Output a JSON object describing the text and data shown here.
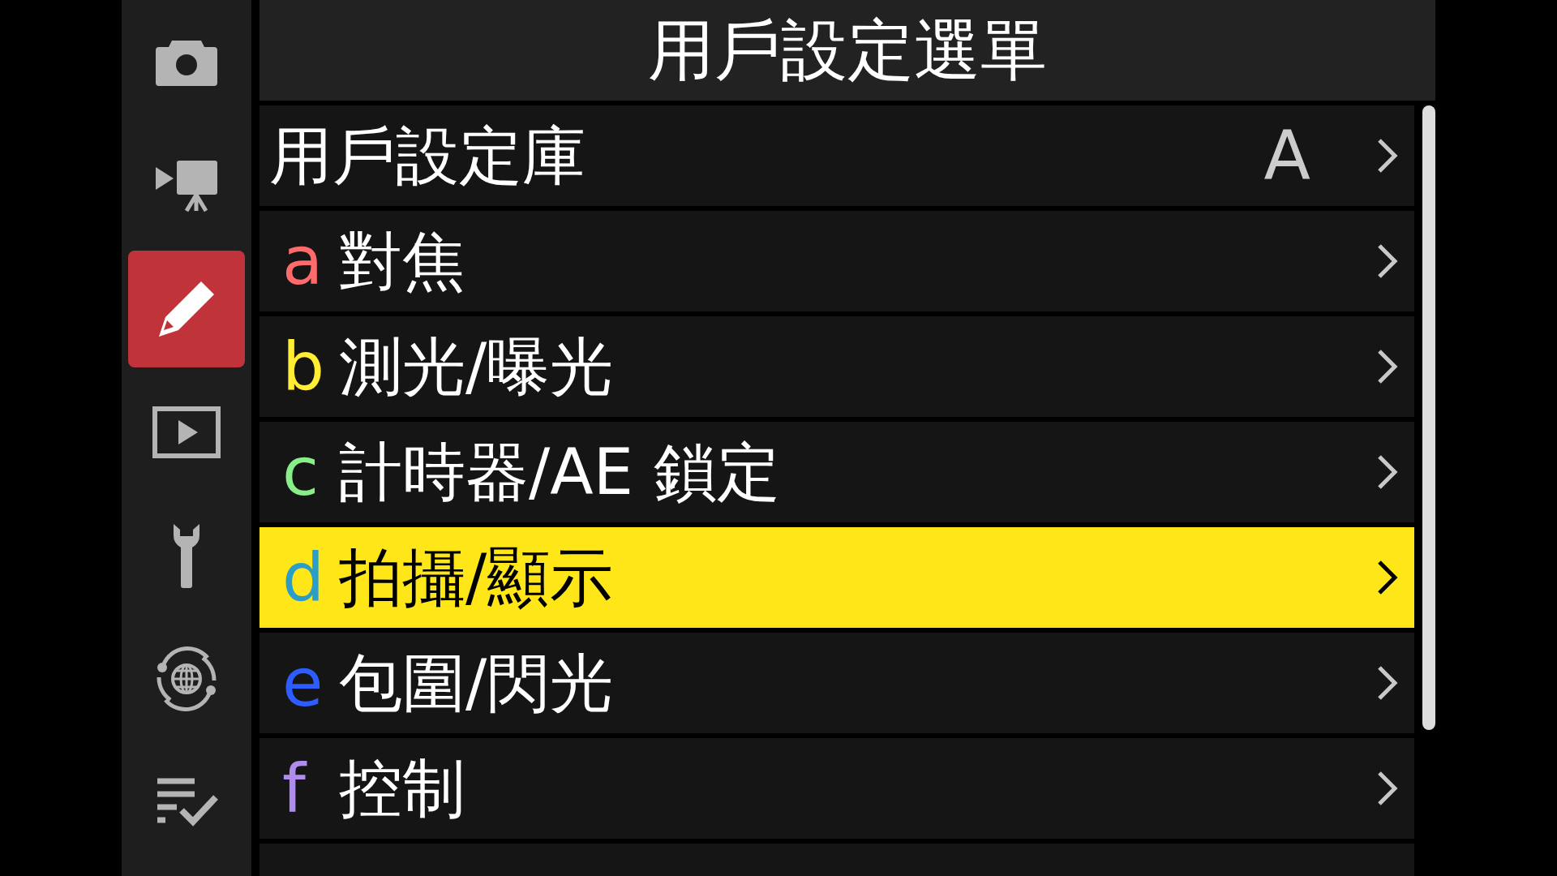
{
  "sidebar": {
    "items": [
      {
        "kind": "camera",
        "selected": false
      },
      {
        "kind": "video",
        "selected": false
      },
      {
        "kind": "pencil",
        "selected": true
      },
      {
        "kind": "playback",
        "selected": false
      },
      {
        "kind": "wrench",
        "selected": false
      },
      {
        "kind": "network",
        "selected": false
      },
      {
        "kind": "list",
        "selected": false
      }
    ]
  },
  "title": "用戶設定選單",
  "menu": [
    {
      "label": "用戶設定庫",
      "value": "A",
      "selected": false
    },
    {
      "letter": "a",
      "color": "#ff6b6b",
      "label": "對焦",
      "selected": false
    },
    {
      "letter": "b",
      "color": "#ffee33",
      "label": "測光/曝光",
      "selected": false
    },
    {
      "letter": "c",
      "color": "#88ee88",
      "label": "計時器/AE 鎖定",
      "selected": false
    },
    {
      "letter": "d",
      "color": "#2a9dc8",
      "label": "拍攝/顯示",
      "selected": true
    },
    {
      "letter": "e",
      "color": "#2d5cff",
      "label": "包圍/閃光",
      "selected": false
    },
    {
      "letter": "f",
      "color": "#b18cf0",
      "label": "控制",
      "selected": false
    }
  ]
}
